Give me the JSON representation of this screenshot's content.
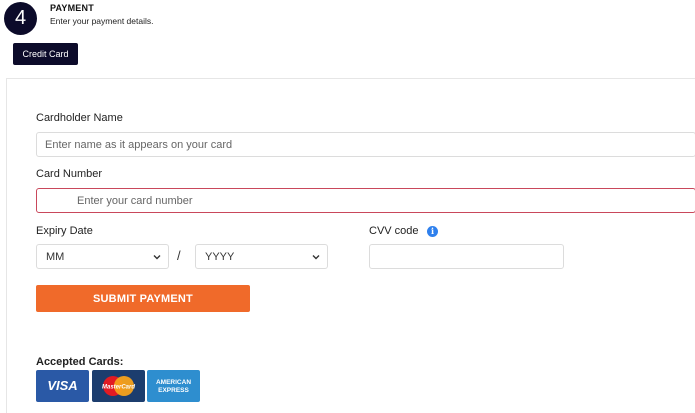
{
  "step": {
    "number": "4",
    "title": "PAYMENT",
    "subtitle": "Enter your payment details."
  },
  "tab": {
    "label": "Credit Card"
  },
  "form": {
    "cardholder_label": "Cardholder Name",
    "cardholder_placeholder": "Enter name as it appears on your card",
    "card_number_label": "Card Number",
    "card_number_placeholder": "Enter your card number",
    "expiry_label": "Expiry Date",
    "expiry_month": "MM",
    "expiry_separator": "/",
    "expiry_year": "YYYY",
    "cvv_label": "CVV code",
    "cvv_info_icon": "info-icon",
    "submit_label": "SUBMIT PAYMENT"
  },
  "accepted": {
    "label": "Accepted Cards:",
    "cards": {
      "visa": "VISA",
      "mastercard": "MasterCard",
      "amex_line1": "AMERICAN",
      "amex_line2": "EXPRESS"
    }
  },
  "colors": {
    "navy": "#0c0b2a",
    "submit": "#f06a2a",
    "error_border": "#c9485b",
    "info_blue": "#2f80ed"
  }
}
